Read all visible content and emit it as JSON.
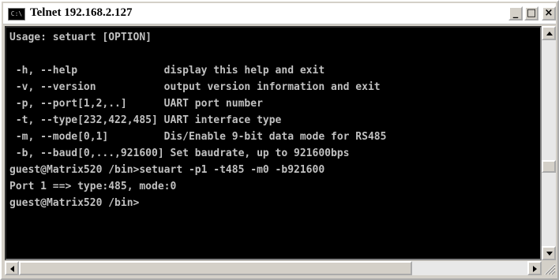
{
  "window": {
    "title": "Telnet 192.168.2.127",
    "icon": "console-icon",
    "icon_text": "C:\\",
    "buttons": {
      "minimize": "_",
      "maximize": "□",
      "close": "×"
    }
  },
  "terminal": {
    "lines": [
      "Usage: setuart [OPTION]",
      "",
      " -h, --help              display this help and exit",
      " -v, --version           output version information and exit",
      " -p, --port[1,2,..]      UART port number",
      " -t, --type[232,422,485] UART interface type",
      " -m, --mode[0,1]         Dis/Enable 9-bit data mode for RS485",
      " -b, --baud[0,...,921600] Set baudrate, up to 921600bps",
      "guest@Matrix520 /bin>setuart -p1 -t485 -m0 -b921600",
      "Port 1 ==> type:485, mode:0",
      "guest@Matrix520 /bin>"
    ],
    "colors": {
      "background": "#000000",
      "text": "#c0c0c0"
    }
  },
  "scrollbars": {
    "vertical": {
      "position_fraction": 0.62
    },
    "horizontal": {
      "position_fraction": 0.0
    }
  }
}
